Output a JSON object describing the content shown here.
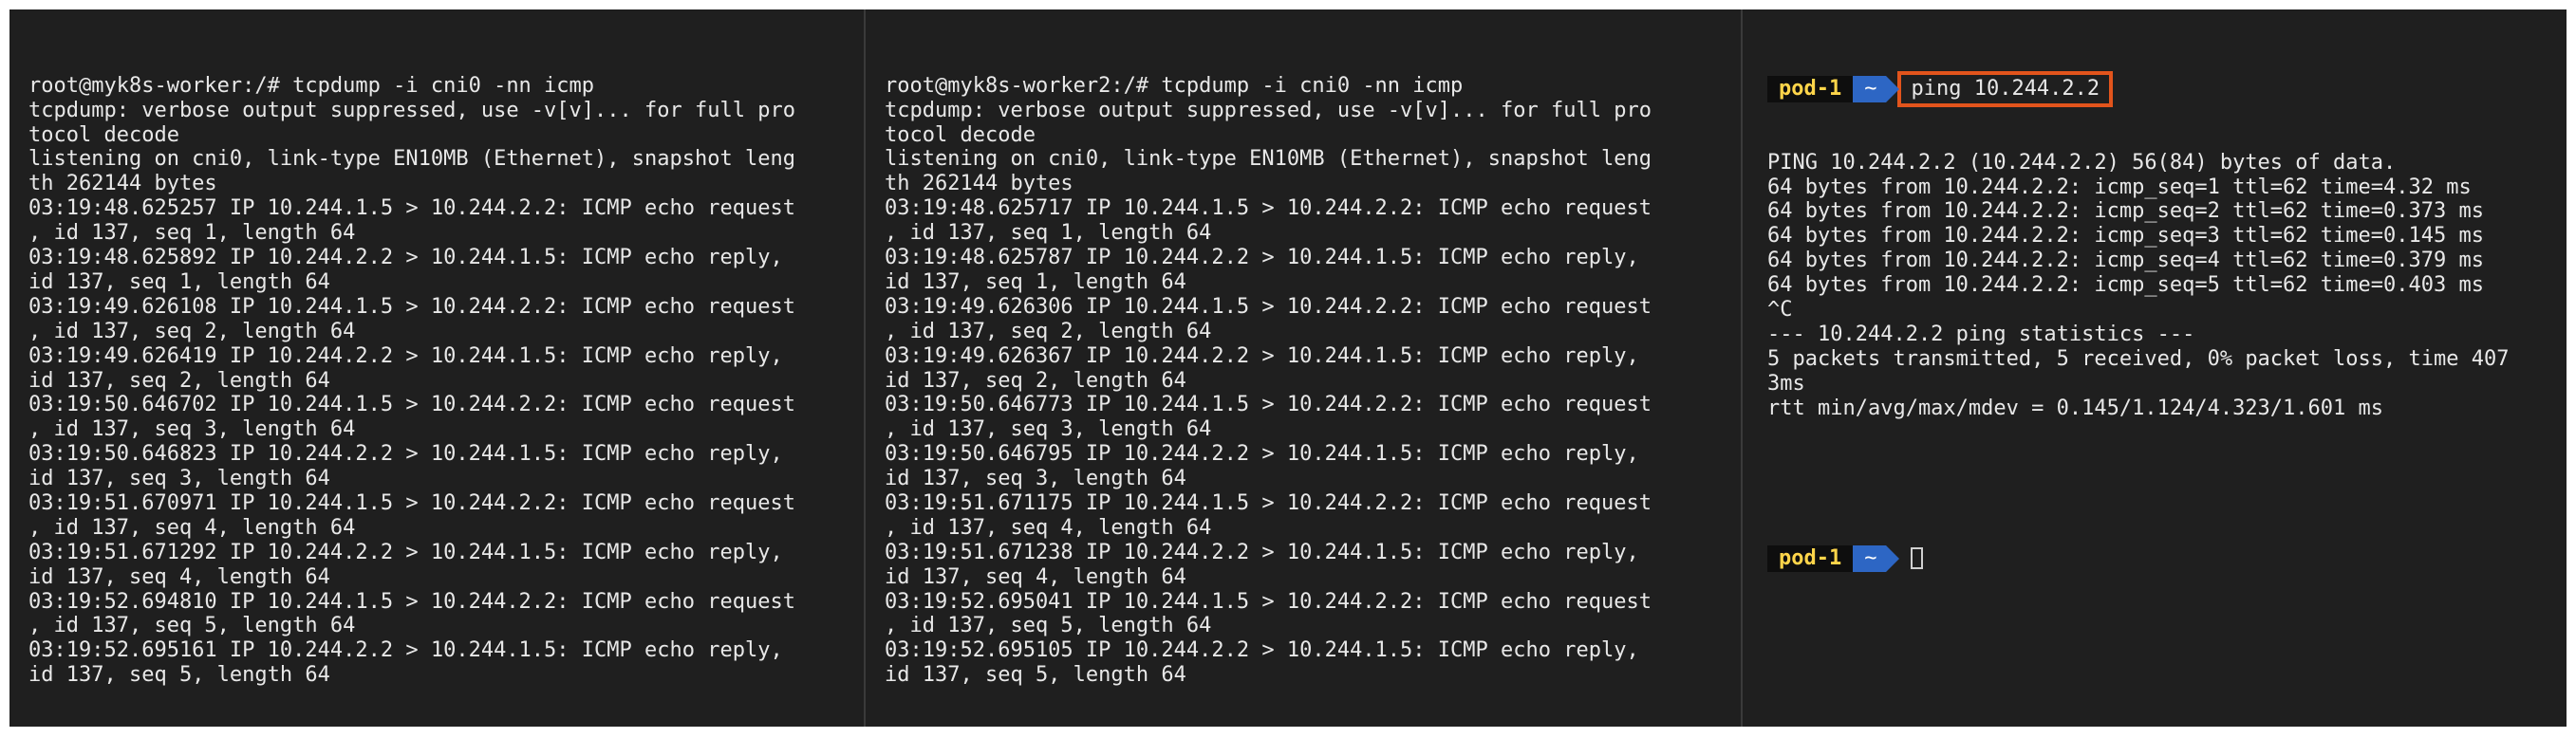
{
  "panes": {
    "worker1": {
      "lines": [
        "root@myk8s-worker:/# tcpdump -i cni0 -nn icmp",
        "tcpdump: verbose output suppressed, use -v[v]... for full pro",
        "tocol decode",
        "listening on cni0, link-type EN10MB (Ethernet), snapshot leng",
        "th 262144 bytes",
        "03:19:48.625257 IP 10.244.1.5 > 10.244.2.2: ICMP echo request",
        ", id 137, seq 1, length 64",
        "03:19:48.625892 IP 10.244.2.2 > 10.244.1.5: ICMP echo reply,",
        "id 137, seq 1, length 64",
        "03:19:49.626108 IP 10.244.1.5 > 10.244.2.2: ICMP echo request",
        ", id 137, seq 2, length 64",
        "03:19:49.626419 IP 10.244.2.2 > 10.244.1.5: ICMP echo reply,",
        "id 137, seq 2, length 64",
        "03:19:50.646702 IP 10.244.1.5 > 10.244.2.2: ICMP echo request",
        ", id 137, seq 3, length 64",
        "03:19:50.646823 IP 10.244.2.2 > 10.244.1.5: ICMP echo reply,",
        "id 137, seq 3, length 64",
        "03:19:51.670971 IP 10.244.1.5 > 10.244.2.2: ICMP echo request",
        ", id 137, seq 4, length 64",
        "03:19:51.671292 IP 10.244.2.2 > 10.244.1.5: ICMP echo reply,",
        "id 137, seq 4, length 64",
        "03:19:52.694810 IP 10.244.1.5 > 10.244.2.2: ICMP echo request",
        ", id 137, seq 5, length 64",
        "03:19:52.695161 IP 10.244.2.2 > 10.244.1.5: ICMP echo reply,",
        "id 137, seq 5, length 64"
      ]
    },
    "worker2": {
      "lines": [
        "root@myk8s-worker2:/# tcpdump -i cni0 -nn icmp",
        "tcpdump: verbose output suppressed, use -v[v]... for full pro",
        "tocol decode",
        "listening on cni0, link-type EN10MB (Ethernet), snapshot leng",
        "th 262144 bytes",
        "03:19:48.625717 IP 10.244.1.5 > 10.244.2.2: ICMP echo request",
        ", id 137, seq 1, length 64",
        "03:19:48.625787 IP 10.244.2.2 > 10.244.1.5: ICMP echo reply,",
        "id 137, seq 1, length 64",
        "03:19:49.626306 IP 10.244.1.5 > 10.244.2.2: ICMP echo request",
        ", id 137, seq 2, length 64",
        "03:19:49.626367 IP 10.244.2.2 > 10.244.1.5: ICMP echo reply,",
        "id 137, seq 2, length 64",
        "03:19:50.646773 IP 10.244.1.5 > 10.244.2.2: ICMP echo request",
        ", id 137, seq 3, length 64",
        "03:19:50.646795 IP 10.244.2.2 > 10.244.1.5: ICMP echo reply,",
        "id 137, seq 3, length 64",
        "03:19:51.671175 IP 10.244.1.5 > 10.244.2.2: ICMP echo request",
        ", id 137, seq 4, length 64",
        "03:19:51.671238 IP 10.244.2.2 > 10.244.1.5: ICMP echo reply,",
        "id 137, seq 4, length 64",
        "03:19:52.695041 IP 10.244.1.5 > 10.244.2.2: ICMP echo request",
        ", id 137, seq 5, length 64",
        "03:19:52.695105 IP 10.244.2.2 > 10.244.1.5: ICMP echo reply,",
        "id 137, seq 5, length 64"
      ]
    },
    "pod": {
      "prompt_host": "pod-1",
      "prompt_dir": "~",
      "command": "ping 10.244.2.2",
      "output": [
        "PING 10.244.2.2 (10.244.2.2) 56(84) bytes of data.",
        "64 bytes from 10.244.2.2: icmp_seq=1 ttl=62 time=4.32 ms",
        "64 bytes from 10.244.2.2: icmp_seq=2 ttl=62 time=0.373 ms",
        "64 bytes from 10.244.2.2: icmp_seq=3 ttl=62 time=0.145 ms",
        "64 bytes from 10.244.2.2: icmp_seq=4 ttl=62 time=0.379 ms",
        "64 bytes from 10.244.2.2: icmp_seq=5 ttl=62 time=0.403 ms",
        "^C",
        "--- 10.244.2.2 ping statistics ---",
        "5 packets transmitted, 5 received, 0% packet loss, time 407",
        "3ms",
        "rtt min/avg/max/mdev = 0.145/1.124/4.323/1.601 ms"
      ],
      "highlight_color": "#e2541c"
    }
  }
}
